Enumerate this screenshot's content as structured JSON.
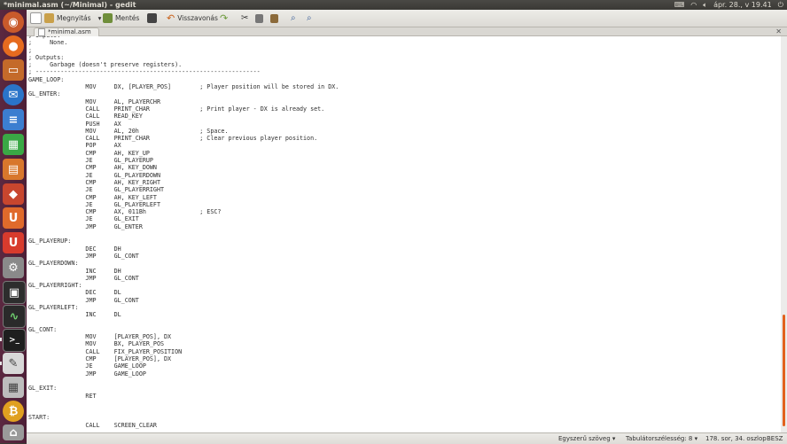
{
  "window": {
    "title": "*minimal.asm (~/Minimal) - gedit"
  },
  "indicators": {
    "datetime": "ápr. 28., v 19.41"
  },
  "toolbar": {
    "new_label": "",
    "open_label": "Megnyitás",
    "save_label": "Mentés",
    "undo_label": "Visszavonás"
  },
  "tab": {
    "label": "*minimal.asm"
  },
  "editor": {
    "lines": [
      "; Inputs:",
      ";     None.",
      ";",
      "; Outputs:",
      ";     Garbage (doesn't preserve registers).",
      "; ---------------------------------------------------------------",
      "GAME_LOOP:",
      "                MOV     DX, [PLAYER_POS]        ; Player position will be stored in DX.",
      "GL_ENTER:",
      "                MOV     AL, PLAYERCHR",
      "                CALL    PRINT_CHAR              ; Print player - DX is already set.",
      "                CALL    READ_KEY",
      "                PUSH    AX",
      "                MOV     AL, 20h                 ; Space.",
      "                CALL    PRINT_CHAR              ; Clear previous player position.",
      "                POP     AX",
      "                CMP     AH, KEY_UP",
      "                JE      GL_PLAYERUP",
      "                CMP     AH, KEY_DOWN",
      "                JE      GL_PLAYERDOWN",
      "                CMP     AH, KEY_RIGHT",
      "                JE      GL_PLAYERRIGHT",
      "                CMP     AH, KEY_LEFT",
      "                JE      GL_PLAYERLEFT",
      "                CMP     AX, 011Bh               ; ESC?",
      "                JE      GL_EXIT",
      "                JMP     GL_ENTER",
      "",
      "GL_PLAYERUP:",
      "                DEC     DH",
      "                JMP     GL_CONT",
      "GL_PLAYERDOWN:",
      "                INC     DH",
      "                JMP     GL_CONT",
      "GL_PLAYERRIGHT:",
      "                DEC     DL",
      "                JMP     GL_CONT",
      "GL_PLAYERLEFT:",
      "                INC     DL",
      "",
      "GL_CONT:",
      "                MOV     [PLAYER_POS], DX",
      "                MOV     BX, PLAYER_POS",
      "                CALL    FIX_PLAYER_POSITION",
      "                CMP     [PLAYER_POS], DX",
      "                JE      GAME_LOOP",
      "                JMP     GAME_LOOP",
      "",
      "GL_EXIT:",
      "                RET",
      "",
      "",
      "START:",
      "                CALL    SCREEN_CLEAR"
    ]
  },
  "status": {
    "syntax": "Egyszerű szöveg",
    "tab_width": "Tabulátorszélesség: 8",
    "position": "178. sor, 34. oszlop",
    "mode": "BESZ"
  },
  "colors": {
    "launcher": "#5b2840",
    "accent": "#e2621e"
  }
}
